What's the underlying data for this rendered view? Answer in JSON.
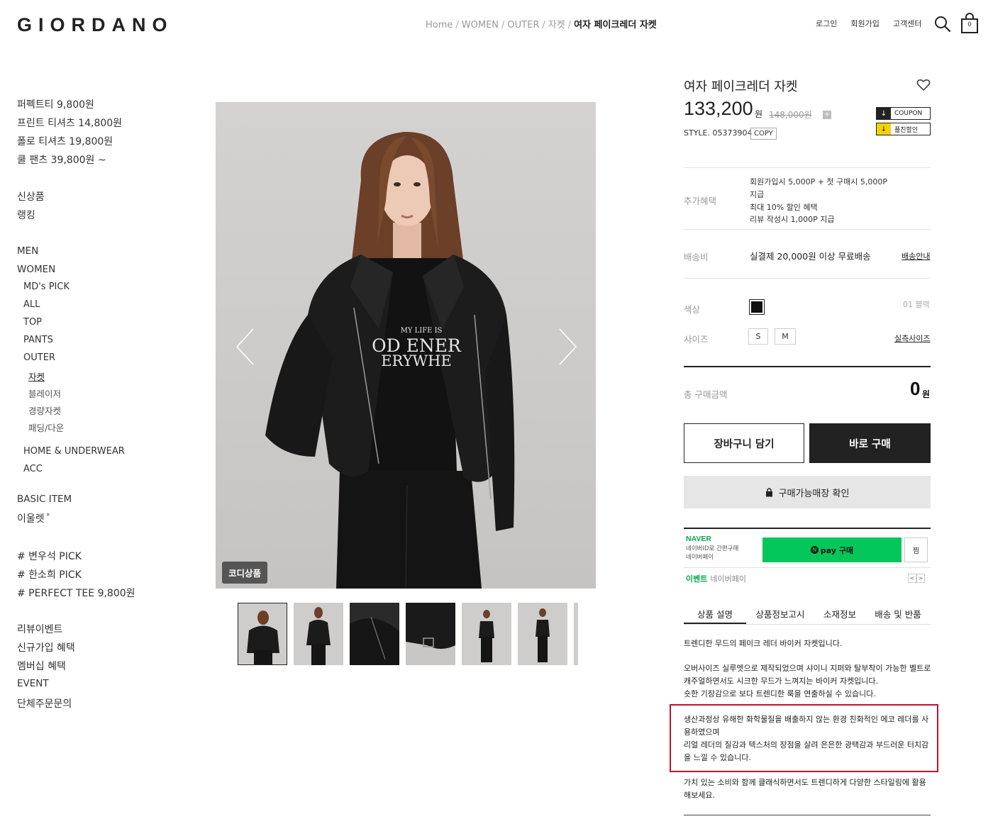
{
  "header": {
    "logo": "GIORDANO",
    "breadcrumb": [
      "Home",
      "WOMEN",
      "OUTER",
      "자켓"
    ],
    "breadcrumb_current": "여자 페이크레더 자켓",
    "links": [
      "로그인",
      "회원가입",
      "고객센터"
    ],
    "cart_count": "0"
  },
  "sidebar": {
    "promos": [
      "퍼펙트티 9,800원",
      "프린트 티셔츠 14,800원",
      "폴로 티셔츠 19,800원",
      "쿨 팬츠 39,800원 ~"
    ],
    "new": "신상품",
    "ranking": "랭킹",
    "men": "MEN",
    "women": "WOMEN",
    "women_sub": [
      "MD's PICK",
      "ALL",
      "TOP",
      "PANTS",
      "OUTER"
    ],
    "outer_sub": [
      "자켓",
      "블레이저",
      "경량자켓",
      "패딩/다운"
    ],
    "home_underwear": "HOME & UNDERWEAR",
    "acc": "ACC",
    "basic_item": "BASIC ITEM",
    "outlet": "이울렛",
    "outlet_mark": "*",
    "tags": [
      "# 변우석 PICK",
      "# 한소희 PICK",
      "# PERFECT TEE 9,800원"
    ],
    "bottom": [
      "리뷰이벤트",
      "신규가입 혜택",
      "멤버십 혜택",
      "EVENT",
      "단체주문문의"
    ]
  },
  "gallery": {
    "badge": "코디상품",
    "tee_text": [
      "MY LIFE IS",
      "OD ENER",
      "ERYWHE"
    ]
  },
  "product": {
    "title": "여자 페이크레더 자켓",
    "price": "133,200",
    "price_unit": "원",
    "original_price": "148,000원",
    "plus": "+",
    "style": "STYLE. 05373904",
    "copy": "COPY",
    "coupon_label": "COUPON",
    "family_discount_label": "플친할인",
    "benefit_label": "추가혜택",
    "benefits": [
      "회원가입시 5,000P + 첫 구매시 5,000P",
      "지급",
      "최대 10% 할인 혜택",
      "리뷰 작성시 1,000P 지급"
    ],
    "shipping_label": "배송비",
    "shipping_text": "실결제 20,000원 이상 무료배송",
    "shipping_link": "배송안내",
    "color_label": "색상",
    "color_name": "01 블랙",
    "size_label": "사이즈",
    "sizes": [
      "S",
      "M"
    ],
    "size_guide": "실측사이즈",
    "total_label": "총 구매금액",
    "total_value": "0",
    "total_unit": "원",
    "cart_button": "장바구니 담기",
    "buy_button": "바로 구매",
    "store_button": "구매가능매장 확인"
  },
  "npay": {
    "naver": "NAVER",
    "sub1": "네이버ID로 간편구매",
    "sub2": "네이버페이",
    "button": "pay 구매",
    "wish": "찜",
    "event": "이벤트",
    "event_sub": "네이버페이",
    "prev": "<",
    "next": ">"
  },
  "tabs": [
    "상품 설명",
    "상품정보고시",
    "소재정보",
    "배송 및 반품"
  ],
  "description": {
    "p1": "트렌디한 무드의 페이크 레더 바이커 자켓입니다.",
    "p2": [
      "오버사이즈 실루엣으로 제작되었으며 샤이니 지퍼와 탈부착이 가능한 벨트로",
      "캐주얼하면서도 시크한 무드가 느껴지는 바이커 자켓입니다.",
      "숏한 기장감으로 보다 트렌디한 룩을 연출하실 수 있습니다."
    ],
    "p3": [
      "생산과정상 유해한 화학물질을 배출하지 않는 환경 친화적인 에코 레더를 사",
      "용하였으며",
      "리얼 레더의 질감과 텍스처의 장점을 살려 은은한 광택감과 부드러운 터치감",
      "을 느낄 수 있습니다."
    ],
    "p4": [
      "가치 있는 소비와 함께 클래식하면서도 트렌디하게 다양한 스타일링에 활용",
      "해보세요."
    ]
  },
  "colors": {
    "npay_green": "#03c75a",
    "highlight_red": "#c8102e",
    "dark": "#222222"
  }
}
